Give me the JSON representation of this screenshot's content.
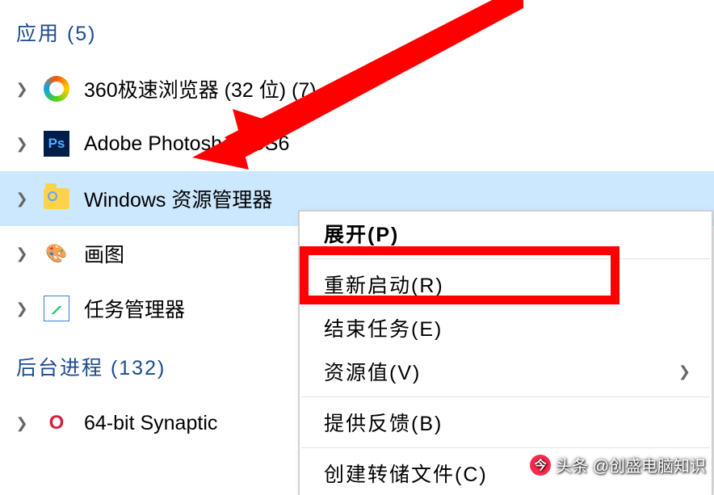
{
  "sections": {
    "apps_header": "应用 (5)",
    "bg_header": "后台进程 (132)"
  },
  "apps": [
    {
      "label": "360极速浏览器 (32 位) (7)",
      "icon": "360"
    },
    {
      "label": "Adobe Photoshop CS6",
      "icon": "ps"
    },
    {
      "label": "Windows 资源管理器",
      "icon": "explorer",
      "selected": true
    },
    {
      "label": "画图",
      "icon": "paint"
    },
    {
      "label": "任务管理器",
      "icon": "taskmgr"
    }
  ],
  "bg": [
    {
      "label": "64-bit Synaptic",
      "icon": "synaptics",
      "truncated": true
    }
  ],
  "ctx": {
    "expand": "展开(P)",
    "restart": "重新启动(R)",
    "end": "结束任务(E)",
    "values": "资源值(V)",
    "feedback": "提供反馈(B)",
    "dump": "创建转储文件(C)"
  },
  "watermark": "头条 @创盛电脑知识"
}
